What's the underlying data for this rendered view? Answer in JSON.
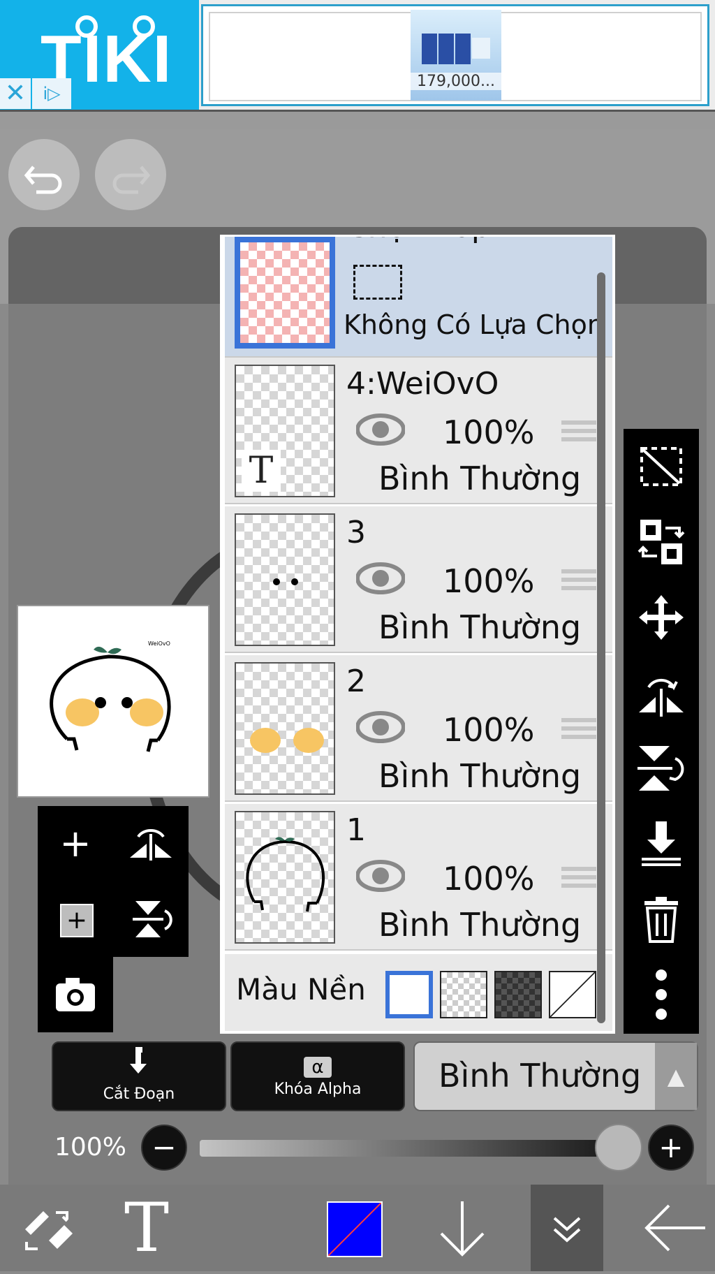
{
  "ad": {
    "brand": "TIKI",
    "close_glyph": "✕",
    "info_glyph": "i▷",
    "product_price": "179,000..."
  },
  "toolbar_top": {
    "undo_icon": "undo-icon",
    "redo_icon": "redo-icon"
  },
  "layers": {
    "selection_layer": {
      "name": "Chọn Lớp",
      "status": "Không Có Lựa Chọn"
    },
    "items": [
      {
        "name": "4:WeiOvO",
        "opacity": "100%",
        "blend": "Bình Thường",
        "type_glyph": "T"
      },
      {
        "name": "3",
        "opacity": "100%",
        "blend": "Bình Thường"
      },
      {
        "name": "2",
        "opacity": "100%",
        "blend": "Bình Thường"
      },
      {
        "name": "1",
        "opacity": "100%",
        "blend": "Bình Thường"
      }
    ],
    "background_label": "Màu Nền"
  },
  "left_tools": {
    "add_glyph": "+",
    "add_copy_glyph": "+"
  },
  "actions": {
    "clip_label": "Cắt Đoạn",
    "alpha_lock_label": "Khóa Alpha",
    "alpha_glyph": "α",
    "blend_mode": "Bình Thường"
  },
  "opacity_slider": {
    "value_label": "100%",
    "value": 1.0,
    "minus": "−",
    "plus": "+"
  },
  "bottom_bar": {
    "text_tool_glyph": "T",
    "color_fill": "#0000ff"
  },
  "colors": {
    "ad_blue": "#13b2e9",
    "selection_blue": "#3a73d8",
    "panel_selected": "#cbd8e9"
  }
}
